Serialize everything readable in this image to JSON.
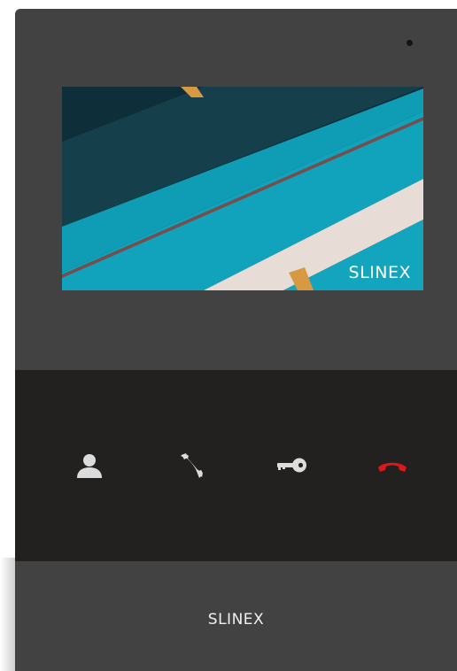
{
  "device": {
    "screen_brand": "SLINEX",
    "panel_brand": "SLINEX",
    "colors": {
      "body": "#424242",
      "control_panel": "#222120",
      "icon": "#dcdcdc",
      "hangup": "#e0161b"
    }
  },
  "controls": [
    {
      "id": "contact",
      "icon": "person-icon"
    },
    {
      "id": "answer",
      "icon": "handset-icon"
    },
    {
      "id": "unlock",
      "icon": "key-icon"
    },
    {
      "id": "hangup",
      "icon": "hangup-icon"
    }
  ]
}
